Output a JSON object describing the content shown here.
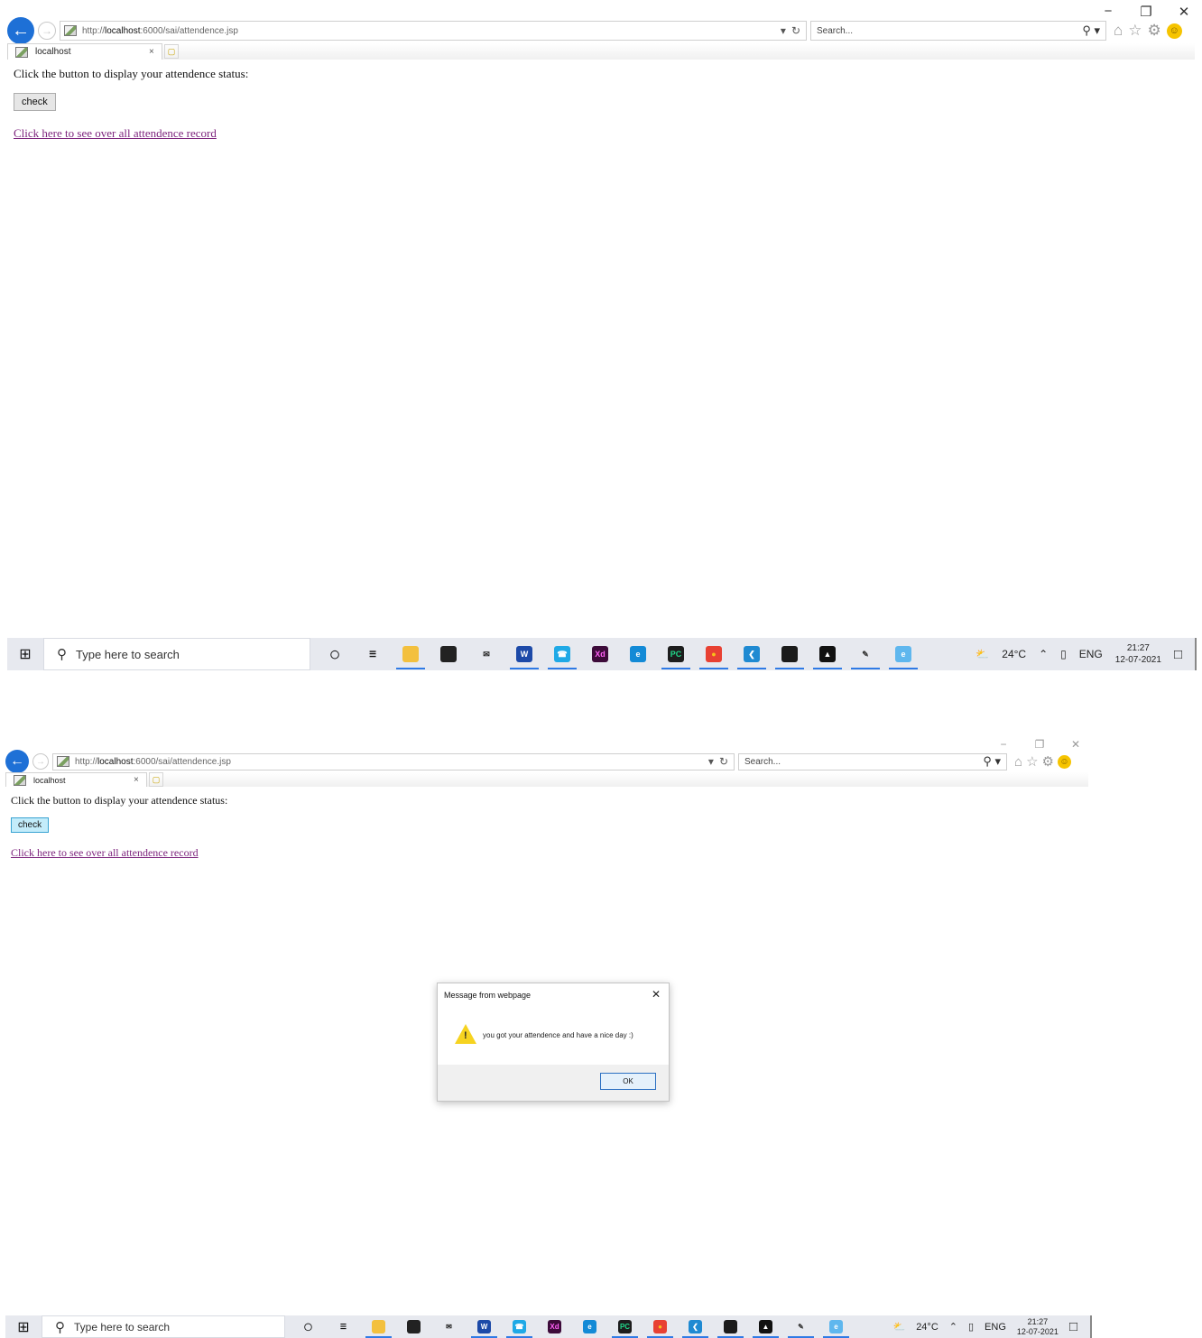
{
  "browser": {
    "window_controls": {
      "minimize": "−",
      "restore": "❐",
      "close": "✕"
    },
    "url_prefix": "http://",
    "url_host": "localhost",
    "url_rest": ":6000/sai/attendence.jsp",
    "address_dropdown": "▾",
    "refresh": "↻",
    "search_placeholder": "Search...",
    "search_dropdown": "▾",
    "tab_label": "localhost",
    "tab_close": "×",
    "icon_names": [
      "back-arrow-icon",
      "forward-arrow-icon",
      "page-icon",
      "refresh-icon",
      "search-icon",
      "home-icon",
      "star-icon",
      "gear-icon",
      "smiley-icon"
    ]
  },
  "page": {
    "instruction": "Click the button to display your attendence status:",
    "button_label": "check",
    "link_text": "Click here to see over all attendence record",
    "link_color": "#7d247d"
  },
  "taskbar": {
    "search_placeholder": "Type here to search",
    "weather": "24°C",
    "language": "ENG",
    "time": "21:27",
    "date": "12-07-2021",
    "apps": [
      {
        "name": "cortana",
        "glyph": "◯",
        "color": "#e7e9ef",
        "fg": "#111"
      },
      {
        "name": "task-view",
        "glyph": "☰",
        "color": "#e7e9ef",
        "fg": "#111"
      },
      {
        "name": "file-explorer",
        "glyph": "",
        "color": "#f3c03e",
        "fg": "#fff",
        "run": true
      },
      {
        "name": "store",
        "glyph": "",
        "color": "#222222",
        "fg": "#fff"
      },
      {
        "name": "mail",
        "glyph": "✉",
        "color": "#e7e9ef",
        "fg": "#222"
      },
      {
        "name": "word",
        "glyph": "W",
        "color": "#1d4aa8",
        "fg": "#fff",
        "run": true
      },
      {
        "name": "whatsapp",
        "glyph": "☎",
        "color": "#1fa9e6",
        "fg": "#fff",
        "run": true
      },
      {
        "name": "adobe-xd",
        "glyph": "Xd",
        "color": "#3d0b3a",
        "fg": "#ff61f6"
      },
      {
        "name": "edge",
        "glyph": "e",
        "color": "#138ad6",
        "fg": "#fff"
      },
      {
        "name": "pycharm",
        "glyph": "PC",
        "color": "#1d1d1d",
        "fg": "#21d789",
        "run": true
      },
      {
        "name": "chrome",
        "glyph": "●",
        "color": "#e84133",
        "fg": "#f7c21a",
        "run": true
      },
      {
        "name": "vscode",
        "glyph": "❮",
        "color": "#1f8ad2",
        "fg": "#fff",
        "run": true
      },
      {
        "name": "terminal",
        "glyph": "",
        "color": "#1b1b1b",
        "fg": "#fff",
        "run": true
      },
      {
        "name": "photos",
        "glyph": "▲",
        "color": "#111111",
        "fg": "#fff",
        "run": true
      },
      {
        "name": "paint",
        "glyph": "✎",
        "color": "#e7e9ef",
        "fg": "#333",
        "run": true
      },
      {
        "name": "internet-explorer",
        "glyph": "e",
        "color": "#5fb7ee",
        "fg": "#fff",
        "run": true
      }
    ]
  },
  "dialog": {
    "title": "Message from webpage",
    "close": "✕",
    "message": "you got your attendence and have a nice day :)",
    "ok_label": "OK",
    "warning_glyph": "!"
  }
}
